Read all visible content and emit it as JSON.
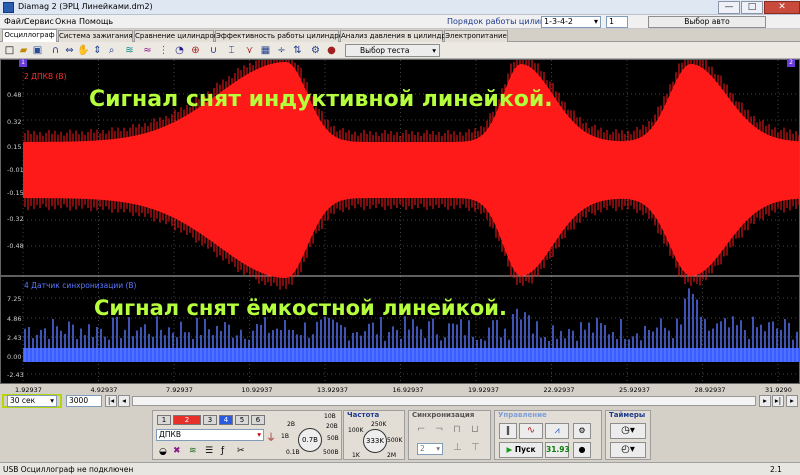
{
  "window": {
    "title": "Diamag 2 (ЭРЦ Линейками.dm2)",
    "minimize": "—",
    "maximize": "□",
    "close": "✕"
  },
  "menu": {
    "items": [
      "Файл",
      "Сервис",
      "Окна",
      "Помощь"
    ],
    "firing_order_label": "Порядок работы цилиндров",
    "firing_order_value": "1-3-4-2",
    "cylinder_value": "1",
    "auto_select": "Выбор авто"
  },
  "tabs": [
    "Осциллограф",
    "Система зажигания",
    "Сравнение цилиндров",
    "Эффективность работы цилиндров",
    "Анализ давления в цилиндре",
    "Электропитание"
  ],
  "toolbar": {
    "test_select": "Выбор теста"
  },
  "scope": {
    "ch2_label": "2 ДПКВ (В)",
    "ch4_label": "4 Датчик синхронизации (В)",
    "annotation_top": "Сигнал снят индуктивной линейкой.",
    "annotation_bottom": "Сигнал снят ёмкостной линейкой.",
    "cursor_left": "1",
    "cursor_right": "2",
    "y_top": [
      "0.48",
      "0.32",
      "0.15",
      "-0.01",
      "-0.15",
      "-0.32",
      "-0.48"
    ],
    "y_bottom": [
      "7.25",
      "4.86",
      "2.43",
      "0.00",
      "-2.43"
    ],
    "x_ticks": [
      "1.92937",
      "4.92937",
      "7.92937",
      "10.92937",
      "13.92937",
      "16.92937",
      "19.92937",
      "22.92937",
      "25.92937",
      "28.92937",
      "31.9290"
    ]
  },
  "nav": {
    "time_window": "30 сек",
    "samples": "3000"
  },
  "channels": {
    "buttons": [
      "1",
      "2",
      "3",
      "4",
      "5",
      "6"
    ],
    "active_channel": "ДПКВ",
    "range_labels": [
      "10В",
      "2В",
      "1В",
      "0.1В",
      "20В",
      "50В",
      "500В"
    ],
    "range_value": "0.7В"
  },
  "frequency": {
    "title": "Частота",
    "labels": [
      "250K",
      "100K",
      "500K",
      "1K",
      "2M"
    ],
    "value": "333K"
  },
  "sync": {
    "title": "Синхронизация",
    "channel": "2"
  },
  "control": {
    "title": "Управление",
    "start_label": "Пуск",
    "rpm_value": "31.93"
  },
  "timers": {
    "title": "Таймеры"
  },
  "status": {
    "text": "USB Осциллограф не подключен",
    "version": "2.1"
  },
  "colors": {
    "ch2": "#ff1a1a",
    "ch4": "#3a5dff",
    "annotation": "#b6ff3c",
    "scope_bg": "#000000"
  }
}
